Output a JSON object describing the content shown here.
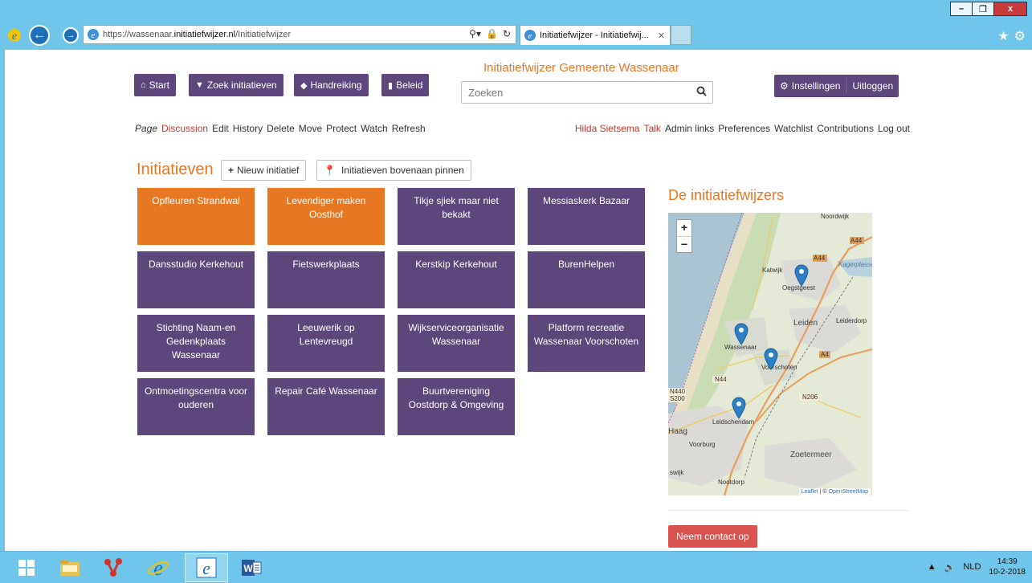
{
  "browser": {
    "url_prefix": "https://wassenaar.",
    "url_domain": "initiatiefwijzer.nl",
    "url_path": "/Initiatiefwijzer",
    "tab_title": "Initiatiefwijzer - Initiatiefwij...",
    "minimize": "–",
    "restore": "❐",
    "close": "x"
  },
  "header": {
    "site_title": "Initiatiefwijzer Gemeente Wassenaar",
    "nav": {
      "start": "Start",
      "zoek": "Zoek initiatieven",
      "handreiking": "Handreiking",
      "beleid": "Beleid"
    },
    "search_placeholder": "Zoeken",
    "settings": "Instellingen",
    "logout": "Uitloggen"
  },
  "wiki_actions": [
    "Page",
    "Discussion",
    "Edit",
    "History",
    "Delete",
    "Move",
    "Protect",
    "Watch",
    "Refresh"
  ],
  "user_links": [
    "Hilda Sietsema",
    "Talk",
    "Admin links",
    "Preferences",
    "Watchlist",
    "Contributions",
    "Log out"
  ],
  "initiatives": {
    "title": "Initiatieven",
    "new_button": "Nieuw initiatief",
    "pin_button": "Initiatieven bovenaan pinnen",
    "tiles": [
      {
        "label": "Opfleuren Strandwal",
        "color": "#e87722"
      },
      {
        "label": "Levendiger maken Oosthof",
        "color": "#e87722"
      },
      {
        "label": "Tikje sjiek maar niet bekakt",
        "color": "#5c467c"
      },
      {
        "label": "Messiaskerk Bazaar",
        "color": "#5c467c"
      },
      {
        "label": "Dansstudio Kerkehout",
        "color": "#5c467c"
      },
      {
        "label": "Fietswerkplaats",
        "color": "#5c467c"
      },
      {
        "label": "Kerstkip Kerkehout",
        "color": "#5c467c"
      },
      {
        "label": "BurenHelpen",
        "color": "#5c467c"
      },
      {
        "label": "Stichting Naam-en Gedenkplaats Wassenaar",
        "color": "#5c467c"
      },
      {
        "label": "Leeuwerik op Lentevreugd",
        "color": "#5c467c"
      },
      {
        "label": "Wijkserviceorganisatie Wassenaar",
        "color": "#5c467c"
      },
      {
        "label": "Platform recreatie Wassenaar Voorschoten",
        "color": "#5c467c"
      },
      {
        "label": "Ontmoetingscentra voor ouderen",
        "color": "#5c467c"
      },
      {
        "label": "Repair Café Wassenaar",
        "color": "#5c467c"
      },
      {
        "label": "Buurtvereniging Oostdorp & Omgeving",
        "color": "#5c467c"
      }
    ]
  },
  "map": {
    "title": "De initiatiefwijzers",
    "zoom_in": "+",
    "zoom_out": "−",
    "attribution_leaflet": "Leaflet",
    "attribution_sep": " | © ",
    "attribution_osm": "OpenStreetMap",
    "labels": {
      "noordwijk": "Noordwijk",
      "katwijk": "Katwijk",
      "oegstgeest": "Oegstgeest",
      "leiden": "Leiden",
      "leiderdorp": "Leiderdorp",
      "wassenaar": "Wassenaar",
      "voorschoten": "Voorschoten",
      "leidschendam": "Leidschendam",
      "haag": "Haag",
      "voorburg": "Voorburg",
      "zoetermeer": "Zoetermeer",
      "nootdorp": "Nootdorp",
      "rijswijk": "swijk",
      "a44a": "A44",
      "a44b": "A44",
      "a4": "A4",
      "n44": "N44",
      "n440": "N440",
      "n206": "N206",
      "s200": "S200",
      "kagerplassen": "Kagerplassen"
    }
  },
  "contact_button": "Neem contact op",
  "taskbar": {
    "lang": "NLD",
    "time": "14:39",
    "date": "10-2-2018"
  },
  "colors": {
    "purple": "#5c467c",
    "orange": "#e87722",
    "red": "#d9534f",
    "chrome": "#6fc6ea"
  }
}
